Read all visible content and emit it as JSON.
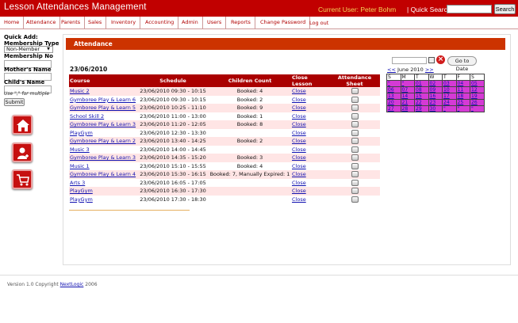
{
  "app": {
    "title": "Lesson Attendances Management"
  },
  "header": {
    "current_user": "Current User: Peter Bohm",
    "quick_search_label": "| Quick Search",
    "search_button": "Search"
  },
  "nav": [
    "Home",
    "Attendance",
    "Parents",
    "Sales",
    "Inventory",
    "Accounting",
    "Admin",
    "Users",
    "Reports",
    "Change Password",
    "Log out"
  ],
  "sidebar": {
    "quick_add": "Quick Add:",
    "membership_type": "Membership Type",
    "membership_value": "Non-Member",
    "membership_no": "Membership No",
    "mothers_name": "Mother's Name",
    "childs_name": "Child's Name",
    "hint": "Use \",\" for multiple",
    "submit": "Submit",
    "icons": [
      "home-icon",
      "user-icon",
      "cart-icon"
    ]
  },
  "attendance": {
    "title": "Attendance",
    "date": "23/06/2010",
    "columns": [
      "Course",
      "Schedule",
      "Children Count",
      "Close Lesson",
      "Attendance Sheet"
    ],
    "rows": [
      {
        "course": "Music 2",
        "schedule": "23/06/2010 09:30 - 10:15",
        "count": "Booked: 4",
        "close": "Close"
      },
      {
        "course": "Gymboree Play & Learn 6",
        "schedule": "23/06/2010 09:30 - 10:15",
        "count": "Booked: 2",
        "close": "Close"
      },
      {
        "course": "Gymboree Play & Learn 5",
        "schedule": "23/06/2010 10:25 - 11:10",
        "count": "Booked: 9",
        "close": "Close"
      },
      {
        "course": "School Skill 2",
        "schedule": "23/06/2010 11:00 - 13:00",
        "count": "Booked: 1",
        "close": "Close"
      },
      {
        "course": "Gymboree Play & Learn 3",
        "schedule": "23/06/2010 11:20 - 12:05",
        "count": "Booked: 8",
        "close": "Close"
      },
      {
        "course": "PlayGym",
        "schedule": "23/06/2010 12:30 - 13:30",
        "count": "",
        "close": "Close"
      },
      {
        "course": "Gymboree Play & Learn 2",
        "schedule": "23/06/2010 13:40 - 14:25",
        "count": "Booked: 2",
        "close": "Close"
      },
      {
        "course": "Music 3",
        "schedule": "23/06/2010 14:00 - 14:45",
        "count": "",
        "close": "Close"
      },
      {
        "course": "Gymboree Play & Learn 3",
        "schedule": "23/06/2010 14:35 - 15:20",
        "count": "Booked: 3",
        "close": "Close"
      },
      {
        "course": "Music 1",
        "schedule": "23/06/2010 15:10 - 15:55",
        "count": "Booked: 4",
        "close": "Close"
      },
      {
        "course": "Gymboree Play & Learn 4",
        "schedule": "23/06/2010 15:30 - 16:15",
        "count": "Booked: 7, Manually Expired: 1",
        "close": "Close"
      },
      {
        "course": "Arts 3",
        "schedule": "23/06/2010 16:05 - 17:05",
        "count": "",
        "close": "Close"
      },
      {
        "course": "PlayGym",
        "schedule": "23/06/2010 16:30 - 17:30",
        "count": "",
        "close": "Close"
      },
      {
        "course": "PlayGym",
        "schedule": "23/06/2010 17:30 - 18:30",
        "count": "",
        "close": "Close"
      }
    ]
  },
  "date_picker": {
    "goto_button": "Go to Date",
    "prev": "<<",
    "month_label": "June 2010",
    "next": ">>",
    "days": [
      "S",
      "M",
      "T",
      "W",
      "T",
      "F",
      "S"
    ],
    "weeks": [
      [
        "\"",
        "\"",
        "01",
        "02",
        "03",
        "04",
        "05"
      ],
      [
        "06",
        "07",
        "08",
        "09",
        "10",
        "11",
        "12"
      ],
      [
        "13",
        "14",
        "15",
        "16",
        "17",
        "18",
        "19"
      ],
      [
        "20",
        "21",
        "22",
        "23",
        "24",
        "25",
        "26"
      ],
      [
        "27",
        "28",
        "29",
        "30",
        "\"",
        "\"",
        "\""
      ]
    ]
  },
  "footer": {
    "text": "Version 1.0 Copyright",
    "link": "NextLogic",
    "year": "2006"
  },
  "colors": {
    "header_bg": "#c10000",
    "accent": "#cc3300",
    "row_alt": "#ffe5e5",
    "calendar_cell": "#d53ad5",
    "user_text": "#f5d55a"
  }
}
